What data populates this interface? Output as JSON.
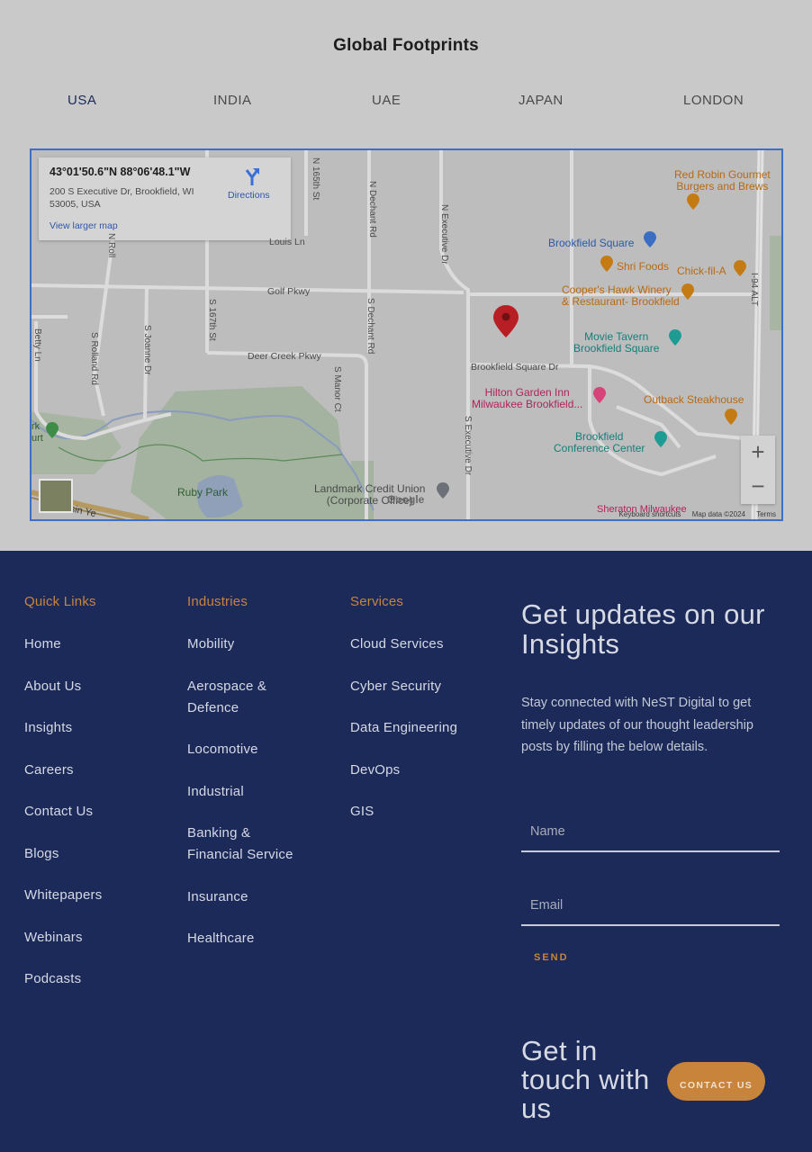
{
  "section_title": "Global Footprints",
  "tabs": [
    {
      "label": "USA",
      "active": true
    },
    {
      "label": "INDIA",
      "active": false
    },
    {
      "label": "UAE",
      "active": false
    },
    {
      "label": "JAPAN",
      "active": false
    },
    {
      "label": "LONDON",
      "active": false
    }
  ],
  "map": {
    "info": {
      "coords": "43°01'50.6\"N 88°06'48.1\"W",
      "address": "200 S Executive Dr, Brookfield, WI 53005, USA",
      "view_larger": "View larger map",
      "directions": "Directions"
    },
    "roads": {
      "louis_ln": "Louis Ln",
      "golf_pkwy": "Golf Pkwy",
      "deer_creek": "Deer Creek Pkwy",
      "brookfield_sq_dr": "Brookfield Square Dr",
      "n_rol": "N Roll",
      "s_167th": "S 167th St",
      "n_165th": "N 165th St",
      "n_dechant": "N Dechant Rd",
      "s_dechant": "S Dechant Rd",
      "n_executive": "N Executive Dr",
      "s_executive": "S Executive Dr",
      "s_manor": "S Manor Ct",
      "s_rolland": "S Rolland Rd",
      "s_joanne": "S Joanne Dr",
      "betty_ln": "Betty Ln",
      "i94": "I-94 ALT"
    },
    "pois": {
      "red_robin": "Red Robin Gourmet\nBurgers and Brews",
      "brookfield_square": "Brookfield Square",
      "shri_foods": "Shri Foods",
      "chick_fil_a": "Chick-fil-A",
      "coopers_hawk": "Cooper's Hawk Winery\n& Restaurant- Brookfield",
      "movie_tavern": "Movie Tavern\nBrookfield Square",
      "hilton": "Hilton Garden Inn\nMilwaukee Brookfield...",
      "outback": "Outback Steakhouse",
      "conference_center": "Brookfield\nConference Center",
      "ruby_park": "Ruby Park",
      "landmark": "Landmark Credit Union\n(Corporate Office)",
      "park_left": "rk\nurt",
      "sheraton": "Sheraton Milwaukee",
      "wisin": "isin Ye"
    },
    "zoom_in": "+",
    "zoom_out": "−",
    "google": "Google",
    "attribution": {
      "shortcuts": "Keyboard shortcuts",
      "mapdata": "Map data ©2024",
      "terms": "Terms"
    }
  },
  "footer": {
    "quick_links": {
      "heading": "Quick Links",
      "items": [
        "Home",
        "About Us",
        "Insights",
        "Careers",
        "Contact Us",
        "Blogs",
        "Whitepapers",
        "Webinars",
        "Podcasts"
      ]
    },
    "industries": {
      "heading": "Industries",
      "items": [
        "Mobility",
        "Aerospace & Defence",
        "Locomotive",
        "Industrial",
        "Banking & Financial Service",
        "Insurance",
        "Healthcare"
      ]
    },
    "services": {
      "heading": "Services",
      "items": [
        "Cloud Services",
        "Cyber Security",
        "Data Engineering",
        "DevOps",
        "GIS"
      ]
    },
    "updates": {
      "title": "Get updates on our Insights",
      "text": "Stay connected with NeST Digital to get timely updates of our thought leadership posts by filling the below details.",
      "name_placeholder": "Name",
      "email_placeholder": "Email",
      "send": "SEND"
    },
    "touch": {
      "title": "Get in touch with us",
      "button": "CONTACT US"
    }
  },
  "colors": {
    "footer_bg": "#1c2a5a",
    "accent": "#c8843a",
    "active_tab": "#1b2a5a"
  }
}
